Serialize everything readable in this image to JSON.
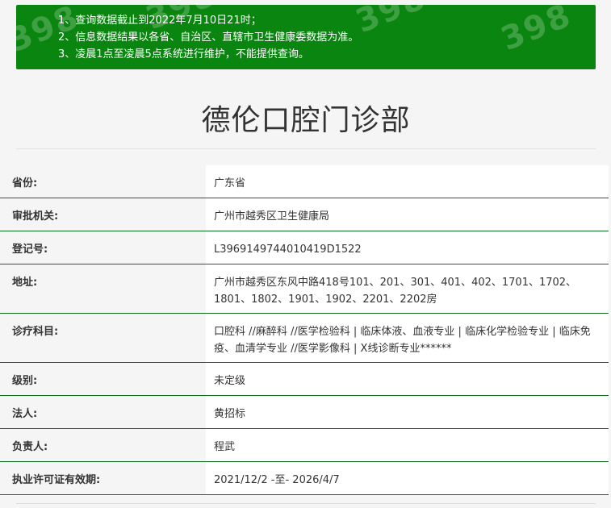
{
  "notice": {
    "lines": [
      "1、查询数据截止到2022年7月10日21时；",
      "2、信息数据结果以各省、自治区、直辖市卫生健康委数据为准。",
      "3、凌晨1点至凌晨5点系统进行维护，不能提供查询。"
    ],
    "watermark": "398"
  },
  "page_title": "德伦口腔门诊部",
  "rows": [
    {
      "label": "省份:",
      "value": "广东省"
    },
    {
      "label": "审批机关:",
      "value": "广州市越秀区卫生健康局"
    },
    {
      "label": "登记号:",
      "value": "L3969149744010419D1522"
    },
    {
      "label": "地址:",
      "value": "广州市越秀区东风中路418号101、201、301、401、402、1701、1702、1801、1802、1901、1902、2201、2202房"
    },
    {
      "label": "诊疗科目:",
      "value": "口腔科 //麻醉科 //医学检验科 | 临床体液、血液专业 | 临床化学检验专业 | 临床免疫、血清学专业 //医学影像科 | X线诊断专业******"
    },
    {
      "label": "级别:",
      "value": "未定级"
    },
    {
      "label": "法人:",
      "value": "黄招标"
    },
    {
      "label": "负责人:",
      "value": "程武"
    },
    {
      "label": "执业许可证有效期:",
      "value": "2021/12/2 -至- 2026/4/7"
    }
  ],
  "colors": {
    "notice_bg": "#0a850f",
    "row_border": "#0a6e1e"
  }
}
